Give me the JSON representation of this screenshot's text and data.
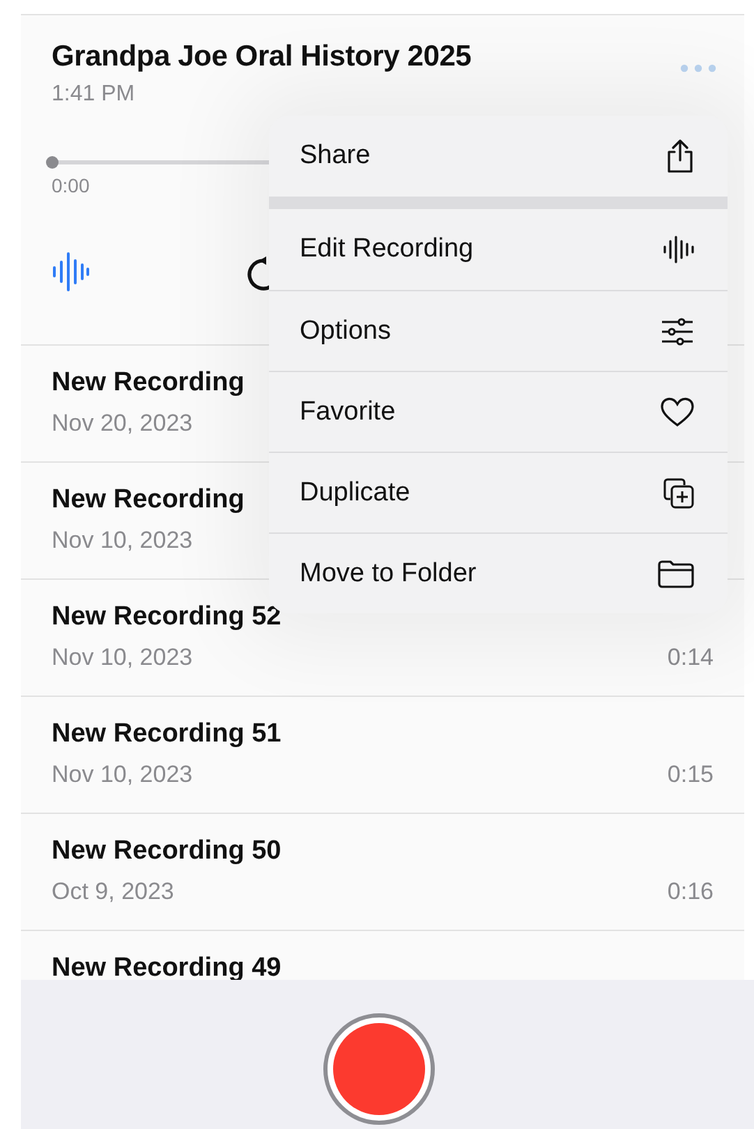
{
  "current_recording": {
    "title": "Grandpa Joe Oral History 2025",
    "time": "1:41 PM",
    "elapsed": "0:00",
    "level": 0
  },
  "menu": {
    "groups": [
      [
        {
          "label": "Share"
        }
      ],
      [
        {
          "label": "Edit Recording"
        },
        {
          "label": "Options"
        },
        {
          "label": "Favorite"
        },
        {
          "label": "Duplicate"
        },
        {
          "label": "Move to Folder"
        }
      ]
    ]
  },
  "recordings": [
    {
      "name": "New Recording",
      "date": "Nov 20, 2023"
    },
    {
      "name": "New Recording",
      "date": "Nov 10, 2023"
    },
    {
      "name": "New Recording 52",
      "date": "Nov 10, 2023",
      "duration": "0:14"
    },
    {
      "name": "New Recording 51",
      "date": "Nov 10, 2023",
      "duration": "0:15"
    },
    {
      "name": "New Recording 50",
      "date": "Oct 9, 2023",
      "duration": "0:16"
    },
    {
      "name": "New Recording 49"
    }
  ]
}
